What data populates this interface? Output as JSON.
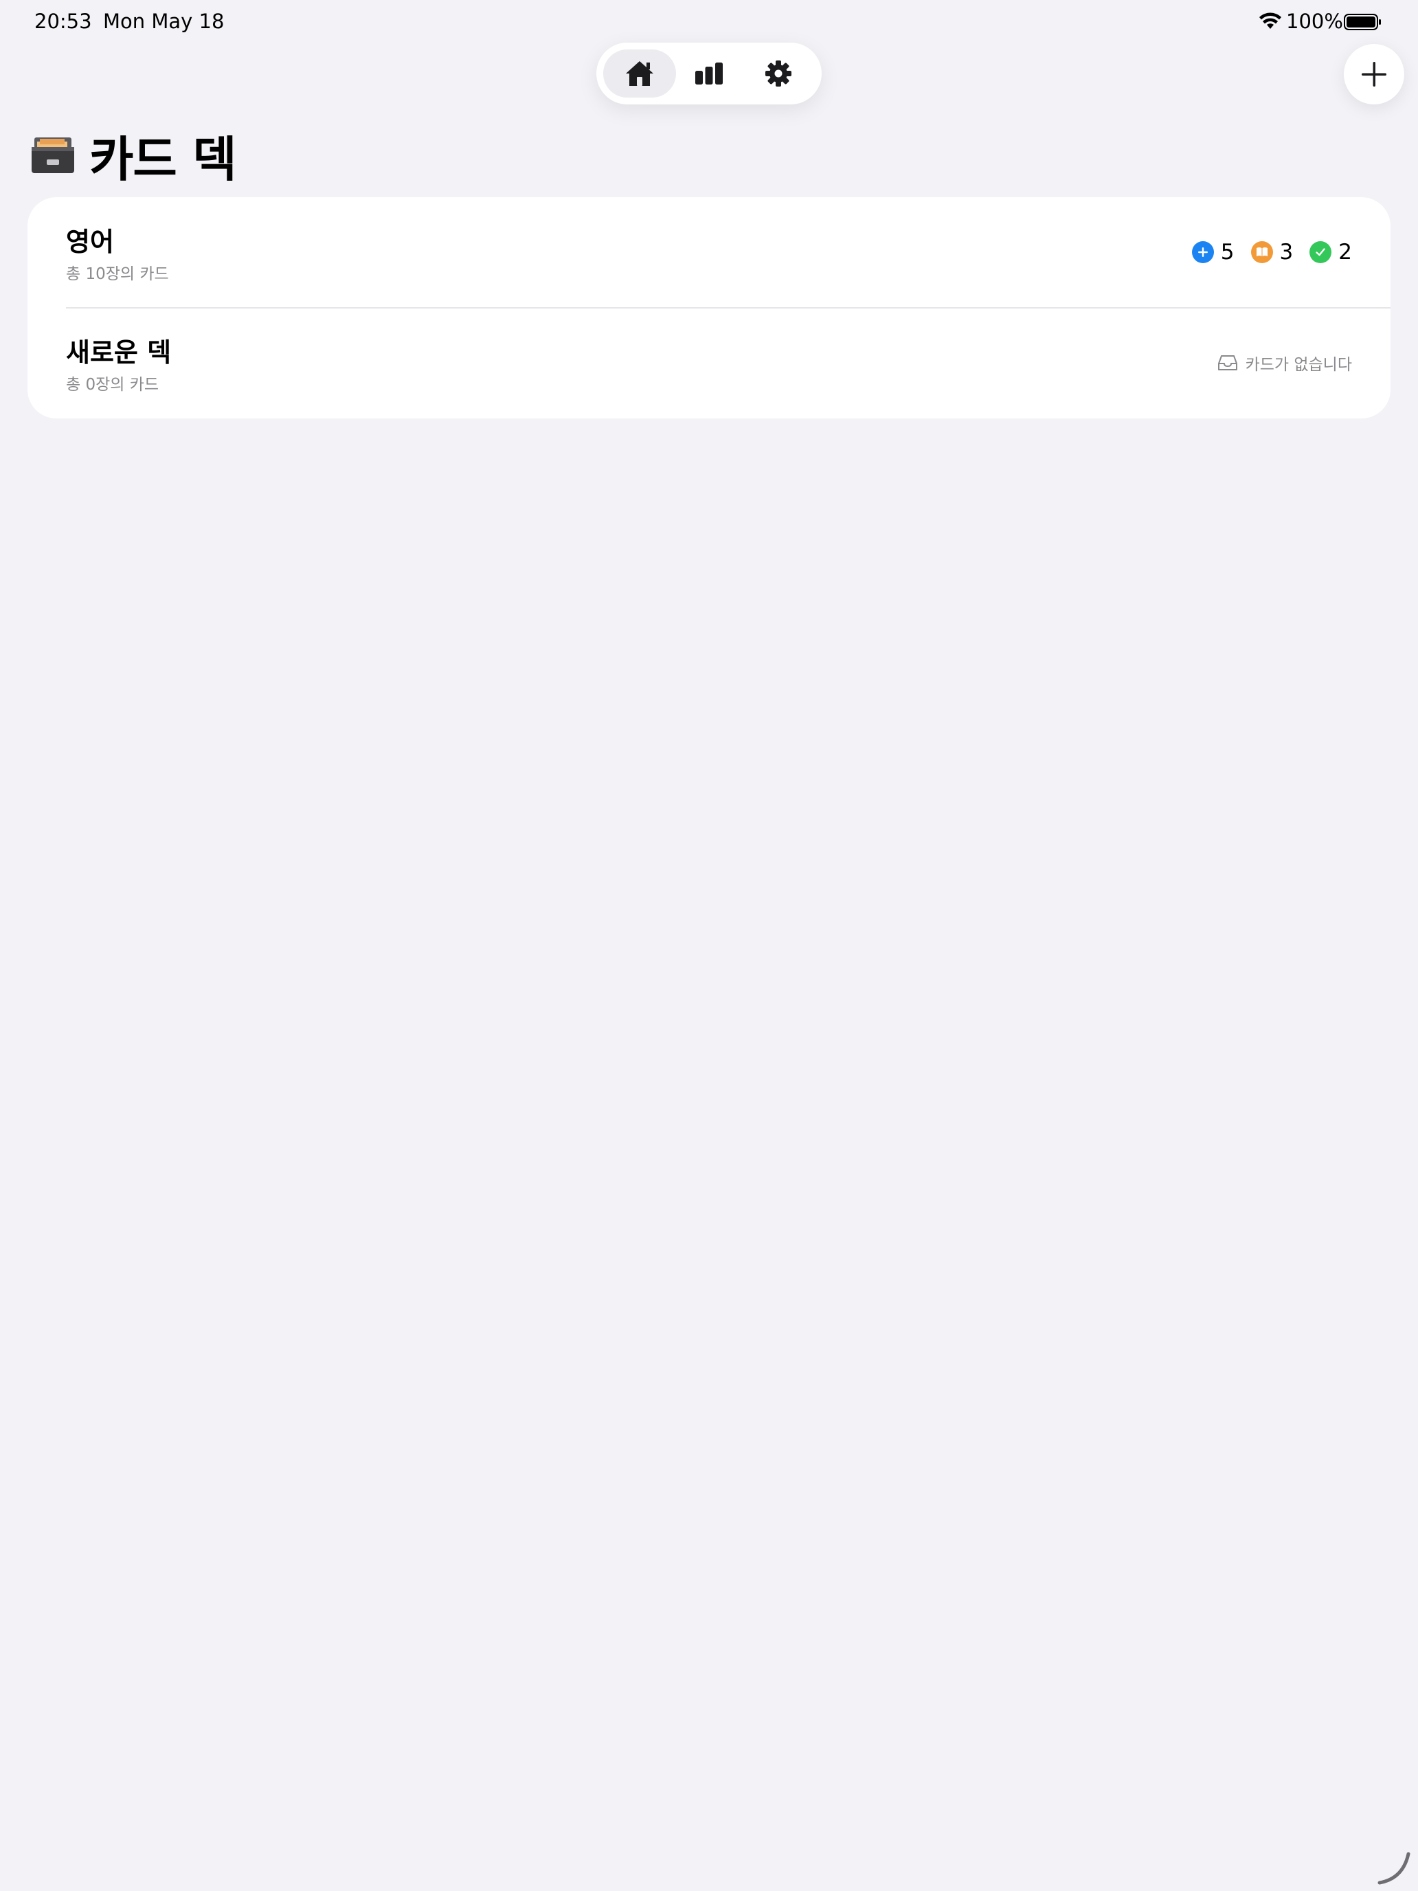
{
  "status_bar": {
    "time": "20:53",
    "date": "Mon May 18",
    "battery_percent": "100%",
    "wifi_icon": "wifi-icon",
    "battery_icon": "battery-full-icon"
  },
  "nav": {
    "tabs": [
      {
        "icon": "house-icon",
        "active": true
      },
      {
        "icon": "bar-chart-icon",
        "active": false
      },
      {
        "icon": "gear-icon",
        "active": false
      }
    ]
  },
  "add_button": {
    "icon": "plus-icon"
  },
  "header": {
    "emoji_icon": "card-file-box-icon",
    "title": "카드 덱"
  },
  "decks": [
    {
      "name": "영어",
      "count_text": "총 10장의 카드",
      "stats": {
        "new": {
          "value": "5",
          "color": "#1C84F2",
          "icon": "plus-circle-icon"
        },
        "learning": {
          "value": "3",
          "color": "#F29A38",
          "icon": "book-circle-icon"
        },
        "done": {
          "value": "2",
          "color": "#34C759",
          "icon": "check-circle-icon"
        }
      }
    },
    {
      "name": "새로운 덱",
      "count_text": "총 0장의 카드",
      "empty_text": "카드가 없습니다",
      "empty_icon": "tray-icon"
    }
  ],
  "colors": {
    "background": "#F2F2F7",
    "card": "#FFFFFF",
    "secondary_text": "#8A8A8E"
  }
}
